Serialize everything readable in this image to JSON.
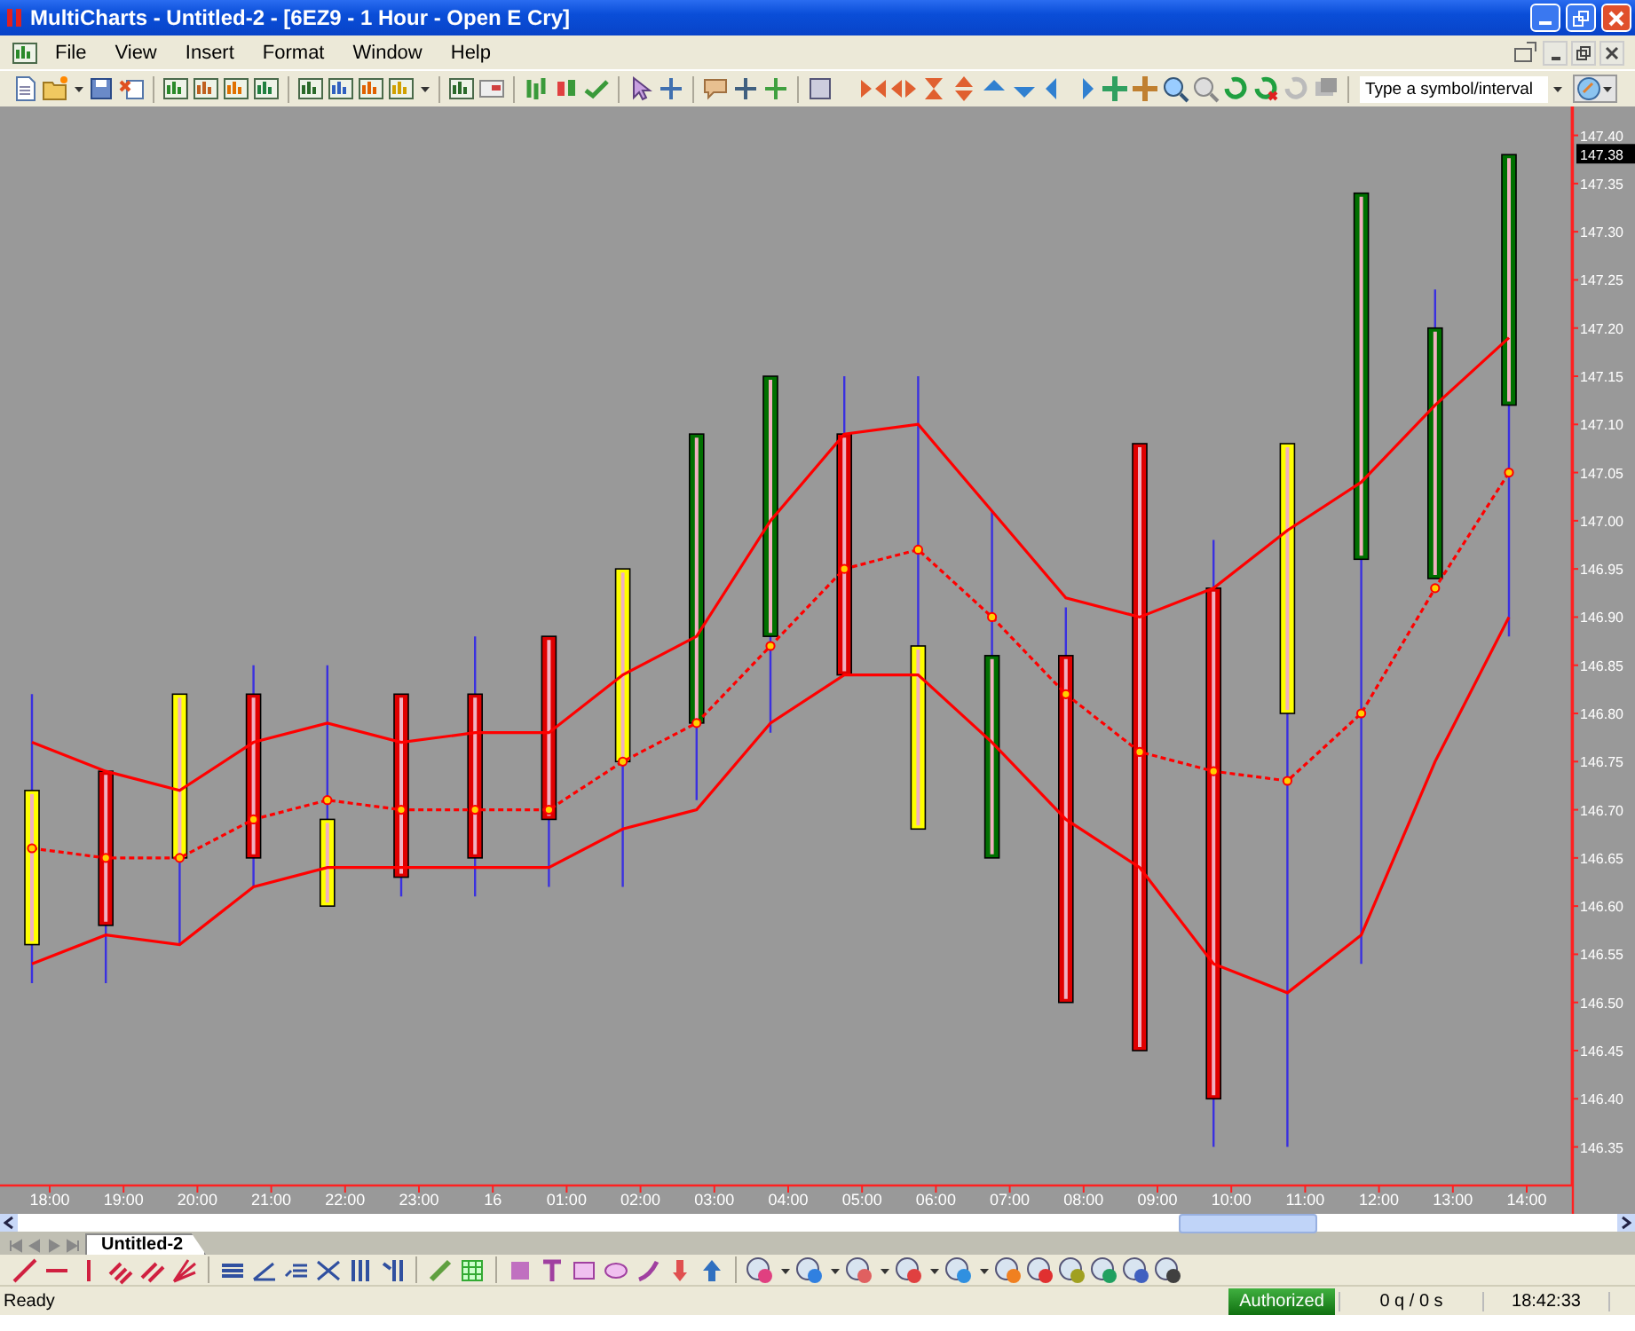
{
  "window": {
    "title": "MultiCharts - Untitled-2 - [6EZ9 - 1 Hour - Open E Cry]"
  },
  "menu": [
    "File",
    "View",
    "Insert",
    "Format",
    "Window",
    "Help"
  ],
  "symbol_field": {
    "placeholder": "Type a symbol/interval"
  },
  "chart": {
    "chart_data": {
      "type": "candlestick",
      "categories": [
        "18:00",
        "19:00",
        "20:00",
        "21:00",
        "22:00",
        "23:00",
        "16",
        "01:00",
        "02:00",
        "03:00",
        "04:00",
        "05:00",
        "06:00",
        "07:00",
        "08:00",
        "09:00",
        "10:00",
        "11:00",
        "12:00",
        "13:00",
        "14:00"
      ],
      "ylim": [
        146.31,
        147.43
      ],
      "yticks": [
        {
          "value": 147.4,
          "label": "147.40"
        },
        {
          "value": 147.35,
          "label": "147.35"
        },
        {
          "value": 147.3,
          "label": "147.30"
        },
        {
          "value": 147.25,
          "label": "147.25"
        },
        {
          "value": 147.2,
          "label": "147.20"
        },
        {
          "value": 147.15,
          "label": "147.15"
        },
        {
          "value": 147.1,
          "label": "147.10"
        },
        {
          "value": 147.05,
          "label": "147.05"
        },
        {
          "value": 147.0,
          "label": "147.00"
        },
        {
          "value": 146.95,
          "label": "146.95"
        },
        {
          "value": 146.9,
          "label": "146.90"
        },
        {
          "value": 146.85,
          "label": "146.85"
        },
        {
          "value": 146.8,
          "label": "146.80"
        },
        {
          "value": 146.75,
          "label": "146.75"
        },
        {
          "value": 146.7,
          "label": "146.70"
        },
        {
          "value": 146.65,
          "label": "146.65"
        },
        {
          "value": 146.6,
          "label": "146.60"
        },
        {
          "value": 146.55,
          "label": "146.55"
        },
        {
          "value": 146.5,
          "label": "146.50"
        },
        {
          "value": 146.45,
          "label": "146.45"
        },
        {
          "value": 146.4,
          "label": "146.40"
        },
        {
          "value": 146.35,
          "label": "146.35"
        }
      ],
      "ohlc": [
        [
          146.72,
          146.82,
          146.52,
          146.56
        ],
        [
          146.74,
          146.74,
          146.52,
          146.58
        ],
        [
          146.82,
          146.82,
          146.56,
          146.65
        ],
        [
          146.82,
          146.85,
          146.62,
          146.65
        ],
        [
          146.69,
          146.85,
          146.6,
          146.6
        ],
        [
          146.82,
          146.82,
          146.61,
          146.63
        ],
        [
          146.82,
          146.88,
          146.61,
          146.65
        ],
        [
          146.88,
          146.88,
          146.62,
          146.69
        ],
        [
          146.95,
          146.95,
          146.62,
          146.75
        ],
        [
          147.09,
          147.09,
          146.71,
          146.79
        ],
        [
          147.15,
          147.15,
          146.78,
          146.88
        ],
        [
          147.09,
          147.15,
          146.84,
          146.84
        ],
        [
          146.87,
          147.15,
          146.68,
          146.68
        ],
        [
          146.86,
          147.01,
          146.65,
          146.65
        ],
        [
          146.86,
          146.91,
          146.5,
          146.5
        ],
        [
          147.08,
          147.08,
          146.45,
          146.45
        ],
        [
          146.93,
          146.98,
          146.35,
          146.4
        ],
        [
          147.08,
          147.08,
          146.35,
          146.8
        ],
        [
          147.34,
          147.34,
          146.54,
          146.96
        ],
        [
          147.2,
          147.24,
          146.94,
          146.94
        ],
        [
          147.38,
          147.38,
          146.88,
          147.12
        ]
      ],
      "colors": [
        "#ffff00",
        "#e00000",
        "#ffff00",
        "#e00000",
        "#ffff00",
        "#e00000",
        "#e00000",
        "#e00000",
        "#ffff00",
        "#007000",
        "#007000",
        "#e00000",
        "#ffff00",
        "#007000",
        "#e00000",
        "#e00000",
        "#e00000",
        "#ffff00",
        "#007000",
        "#007000",
        "#007000"
      ],
      "annotations": [
        "147.38"
      ]
    },
    "overlay": {
      "chart_data": {
        "type": "line",
        "ylim": [
          146.31,
          147.43
        ],
        "series": [
          {
            "color": "#ff0000",
            "line_style": "solid",
            "values": [
              146.77,
              146.74,
              146.72,
              146.77,
              146.79,
              146.77,
              146.78,
              146.78,
              146.84,
              146.88,
              147.0,
              147.09,
              147.1,
              147.01,
              146.92,
              146.9,
              146.93,
              146.99,
              147.04,
              147.12,
              147.19
            ]
          },
          {
            "color": "#ff0000",
            "line_style": "dashed",
            "marker": "circle",
            "values": [
              146.66,
              146.65,
              146.65,
              146.69,
              146.71,
              146.7,
              146.7,
              146.7,
              146.75,
              146.79,
              146.87,
              146.95,
              146.97,
              146.9,
              146.82,
              146.76,
              146.74,
              146.73,
              146.8,
              146.93,
              147.05
            ]
          },
          {
            "color": "#ff0000",
            "line_style": "solid",
            "values": [
              146.54,
              146.57,
              146.56,
              146.62,
              146.64,
              146.64,
              146.64,
              146.64,
              146.68,
              146.7,
              146.79,
              146.84,
              146.84,
              146.77,
              146.69,
              146.64,
              146.54,
              146.51,
              146.57,
              146.75,
              146.9
            ]
          }
        ]
      }
    }
  },
  "chart_tabs": [
    {
      "label": "Untitled-2",
      "selected": true
    }
  ],
  "status_bar": {
    "message": "Ready",
    "connection": "Authorized",
    "quotes": "0 q / 0 s",
    "time": "18:42:33"
  }
}
